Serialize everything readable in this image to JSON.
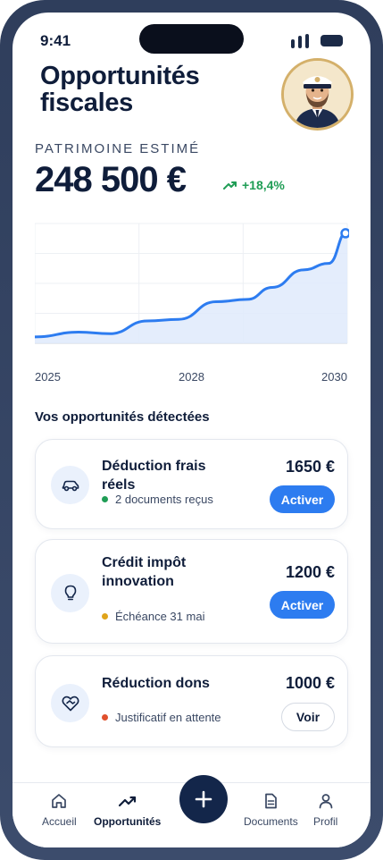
{
  "status_bar": {
    "time": "9:41"
  },
  "header": {
    "title": "Opportunités fiscales"
  },
  "estimate": {
    "label": "PATRIMOINE ESTIMÉ",
    "value": "248 500 €",
    "trend": "+18,4%"
  },
  "chart_data": {
    "type": "area",
    "x_ticks": [
      "2025",
      "2028",
      "2030"
    ],
    "x": [
      2025.0,
      2025.7,
      2026.2,
      2026.8,
      2027.3,
      2027.9,
      2028.4,
      2028.8,
      2029.3,
      2029.7,
      2030.0
    ],
    "values": [
      8,
      14,
      12,
      28,
      30,
      52,
      55,
      70,
      92,
      100,
      140
    ],
    "ylim": [
      0,
      150
    ],
    "grid": true,
    "colors": {
      "line": "#2d7cf0",
      "fill": "#dfeafb"
    }
  },
  "opportunities": {
    "title": "Vos opportunités détectées",
    "items": [
      {
        "icon": "car-icon",
        "title": "Déduction frais réels",
        "amount": "1650 €",
        "status": "2 documents reçus",
        "status_color": "#1f9d55",
        "action": "Activer"
      },
      {
        "icon": "lightbulb-icon",
        "title": "Crédit impôt innovation",
        "amount": "1200 €",
        "status": "Échéance 31 mai",
        "status_color": "#e0a41a",
        "action": "Activer"
      },
      {
        "icon": "heart-handshake-icon",
        "title": "Réduction dons",
        "amount": "1000 €",
        "status": "Justificatif en attente",
        "status_color": "#e0502d",
        "action": "Voir"
      }
    ]
  },
  "tabbar": {
    "items": [
      {
        "label": "Accueil",
        "icon": "home-icon"
      },
      {
        "label": "Opportunités",
        "icon": "trend-icon"
      },
      {
        "label": "Documents",
        "icon": "document-icon"
      },
      {
        "label": "Profil",
        "icon": "profile-icon"
      }
    ],
    "fab_icon": "plus-icon"
  }
}
